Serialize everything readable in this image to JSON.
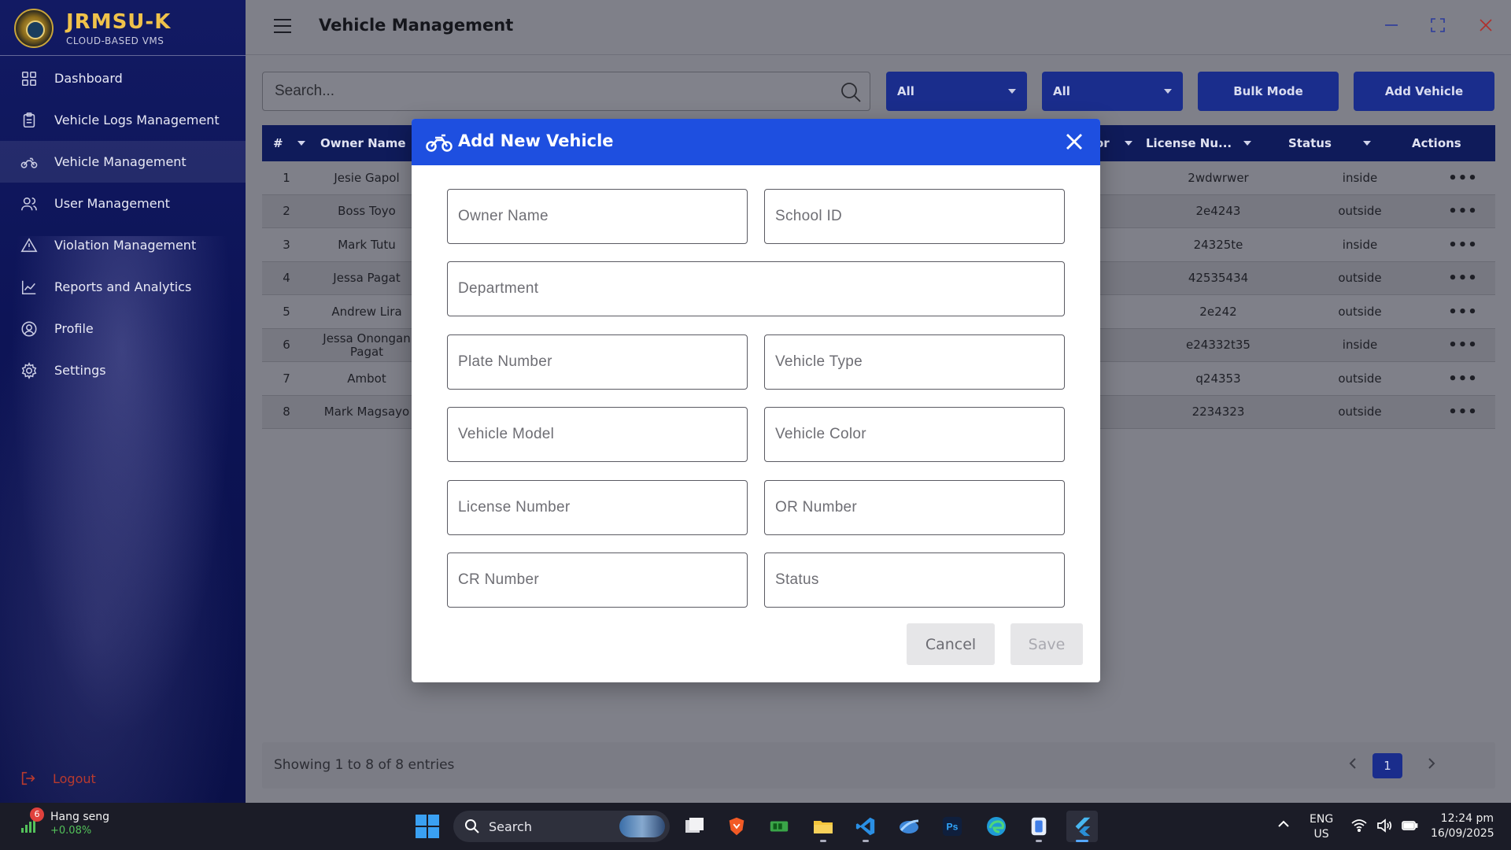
{
  "brand": {
    "title": "JRMSU-K",
    "subtitle": "CLOUD-BASED VMS"
  },
  "sidebar": {
    "items": [
      {
        "label": "Dashboard",
        "icon": "dashboard-icon"
      },
      {
        "label": "Vehicle Logs Management",
        "icon": "clipboard-icon"
      },
      {
        "label": "Vehicle Management",
        "icon": "motorcycle-icon",
        "active": true
      },
      {
        "label": "User Management",
        "icon": "users-icon"
      },
      {
        "label": "Violation Management",
        "icon": "warning-icon"
      },
      {
        "label": "Reports and Analytics",
        "icon": "chart-line-icon"
      },
      {
        "label": "Profile",
        "icon": "user-circle-icon"
      },
      {
        "label": "Settings",
        "icon": "gear-icon"
      }
    ],
    "logout_label": "Logout"
  },
  "header": {
    "title": "Vehicle Management"
  },
  "toolbar": {
    "search_placeholder": "Search...",
    "filter1_value": "All",
    "filter2_value": "All",
    "bulk_label": "Bulk Mode",
    "add_label": "Add Vehicle"
  },
  "table": {
    "columns": {
      "num": "#",
      "owner": "Owner Name",
      "partial": "or",
      "license": "License Nu...",
      "status": "Status",
      "actions": "Actions"
    },
    "rows": [
      {
        "num": "1",
        "owner": "Jesie Gapol",
        "license": "2wdwrwer",
        "status": "inside",
        "actions": "•••"
      },
      {
        "num": "2",
        "owner": "Boss Toyo",
        "license": "2e4243",
        "status": "outside",
        "actions": "•••"
      },
      {
        "num": "3",
        "owner": "Mark Tutu",
        "license": "24325te",
        "status": "inside",
        "actions": "•••"
      },
      {
        "num": "4",
        "owner": "Jessa Pagat",
        "license": "42535434",
        "status": "outside",
        "actions": "•••"
      },
      {
        "num": "5",
        "owner": "Andrew Lira",
        "license": "2e242",
        "status": "outside",
        "actions": "•••"
      },
      {
        "num": "6",
        "owner": "Jessa Onongan Pagat",
        "license": "e24332t35",
        "status": "inside",
        "actions": "•••"
      },
      {
        "num": "7",
        "owner": "Ambot",
        "license": "q24353",
        "status": "outside",
        "actions": "•••"
      },
      {
        "num": "8",
        "owner": "Mark Magsayo",
        "license": "2234323",
        "status": "outside",
        "actions": "•••"
      }
    ]
  },
  "pagination": {
    "summary": "Showing 1 to 8 of 8 entries",
    "current_page": "1"
  },
  "modal": {
    "title": "Add New Vehicle",
    "fields": {
      "owner_name": "Owner Name",
      "school_id": "School ID",
      "department": "Department",
      "plate_number": "Plate Number",
      "vehicle_type": "Vehicle Type",
      "vehicle_model": "Vehicle Model",
      "vehicle_color": "Vehicle Color",
      "license_number": "License Number",
      "or_number": "OR Number",
      "cr_number": "CR Number",
      "status": "Status"
    },
    "cancel_label": "Cancel",
    "save_label": "Save"
  },
  "taskbar": {
    "ticker_name": "Hang seng",
    "ticker_change": "+0.08%",
    "ticker_badge": "6",
    "search_label": "Search",
    "lang_line1": "ENG",
    "lang_line2": "US",
    "time": "12:24 pm",
    "date": "16/09/2025"
  },
  "colors": {
    "sidebar_bg": "#0d1457",
    "brand_gold": "#f0c24a",
    "primary_button": "#1a2d8c",
    "modal_header": "#1e4fe0",
    "logout_red": "#b83a2e"
  }
}
